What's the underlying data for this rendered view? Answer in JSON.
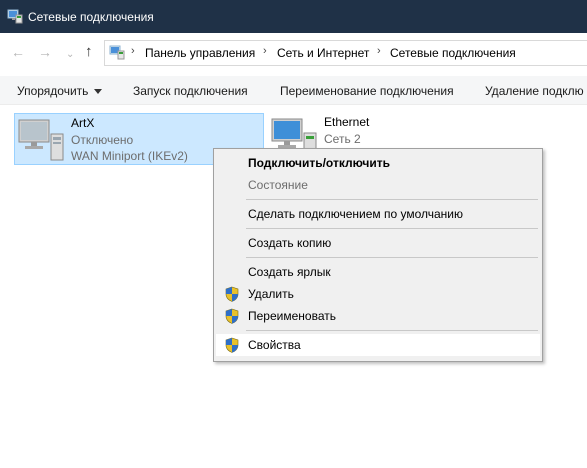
{
  "window": {
    "title": "Сетевые подключения"
  },
  "breadcrumb": [
    "Панель управления",
    "Сеть и Интернет",
    "Сетевые подключения"
  ],
  "nav": {
    "back": "←",
    "forward": "→",
    "dropdown": "⌄",
    "up": "↑",
    "sep": "›"
  },
  "toolbar": {
    "organize": "Упорядочить",
    "start": "Запуск подключения",
    "rename": "Переименование подключения",
    "delete": "Удаление подклю"
  },
  "connections": [
    {
      "name": "ArtX",
      "status": "Отключено",
      "device": "WAN Miniport (IKEv2)",
      "icon": "vpn-computer-icon"
    },
    {
      "name": "Ethernet",
      "status": "Сеть 2",
      "device": "",
      "icon": "ethernet-computer-icon"
    }
  ],
  "context_menu": {
    "connect": "Подключить/отключить",
    "status": "Состояние",
    "set_default": "Сделать подключением по умолчанию",
    "copy": "Создать копию",
    "shortcut": "Создать ярлык",
    "delete": "Удалить",
    "rename": "Переименовать",
    "properties": "Свойства"
  },
  "colors": {
    "titlebar": "#1f3147",
    "selection": "#cce8ff",
    "menu_bg": "#f0f0f0"
  }
}
